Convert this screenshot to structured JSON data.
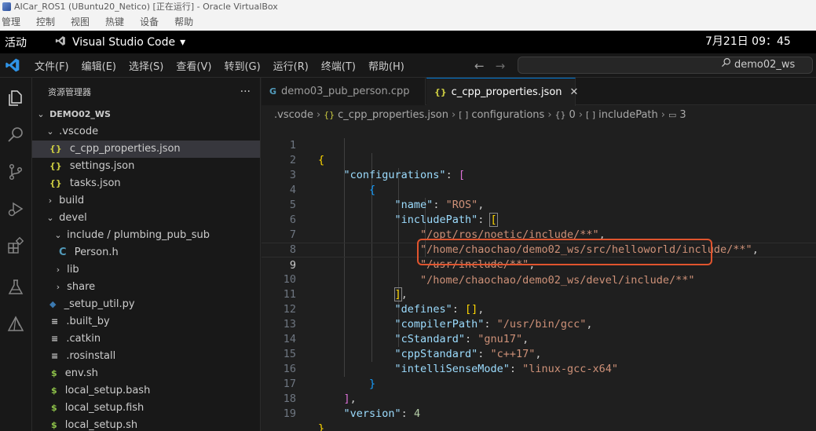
{
  "host": {
    "window_title": "AICar_ROS1 (UBuntu20_Netico) [正在运行] - Oracle VirtualBox",
    "menu": [
      "管理",
      "控制",
      "视图",
      "热键",
      "设备",
      "帮助"
    ]
  },
  "gnome": {
    "activities": "活动",
    "app_name": "Visual Studio Code",
    "app_arrow": "▾",
    "clock": "7月21日  09：45"
  },
  "vscode": {
    "menu": [
      "文件(F)",
      "编辑(E)",
      "选择(S)",
      "查看(V)",
      "转到(G)",
      "运行(R)",
      "终端(T)",
      "帮助(H)"
    ],
    "search_text": "demo02_ws"
  },
  "sidebar": {
    "title": "资源管理器",
    "more": "···",
    "items": [
      {
        "label": "DEMO02_WS"
      },
      {
        "label": ".vscode"
      },
      {
        "label": "c_cpp_properties.json"
      },
      {
        "label": "settings.json"
      },
      {
        "label": "tasks.json"
      },
      {
        "label": "build"
      },
      {
        "label": "devel"
      },
      {
        "label": "include / plumbing_pub_sub"
      },
      {
        "label": "Person.h"
      },
      {
        "label": "lib"
      },
      {
        "label": "share"
      },
      {
        "label": "_setup_util.py"
      },
      {
        "label": ".built_by"
      },
      {
        "label": ".catkin"
      },
      {
        "label": ".rosinstall"
      },
      {
        "label": "env.sh"
      },
      {
        "label": "local_setup.bash"
      },
      {
        "label": "local_setup.fish"
      },
      {
        "label": "local_setup.sh"
      }
    ]
  },
  "tabs": [
    {
      "label": "demo03_pub_person.cpp"
    },
    {
      "label": "c_cpp_properties.json"
    }
  ],
  "breadcrumb": [
    ".vscode",
    "c_cpp_properties.json",
    "configurations",
    "0",
    "includePath",
    "3"
  ],
  "editor": {
    "line_numbers": [
      "1",
      "2",
      "3",
      "4",
      "5",
      "6",
      "7",
      "8",
      "9",
      "10",
      "11",
      "12",
      "13",
      "14",
      "15",
      "16",
      "17",
      "18",
      "19"
    ],
    "t": {
      "configurations": "\"configurations\"",
      "name": "\"name\"",
      "ros": "\"ROS\"",
      "includePath": "\"includePath\"",
      "p1": "\"/opt/ros/noetic/include/**\"",
      "p2": "\"/home/chaochao/demo02_ws/src/helloworld/include/**\"",
      "p3": "\"/usr/include/**\"",
      "p4": "\"/home/chaochao/demo02_ws/devel/include/**\"",
      "defines": "\"defines\"",
      "compilerPath": "\"compilerPath\"",
      "gcc": "\"/usr/bin/gcc\"",
      "cStandard": "\"cStandard\"",
      "gnu17": "\"gnu17\"",
      "cppStandard": "\"cppStandard\"",
      "cpp17": "\"c++17\"",
      "intelliSenseMode": "\"intelliSenseMode\"",
      "mode": "\"linux-gcc-x64\"",
      "version": "\"version\"",
      "four": "4"
    }
  }
}
